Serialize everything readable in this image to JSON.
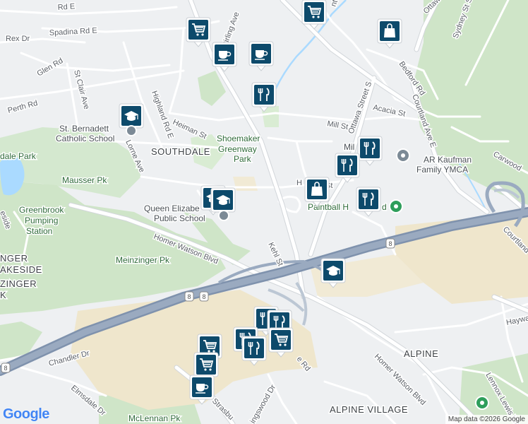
{
  "map": {
    "areas": {
      "southdale": "SOUTHDALE",
      "alpine": "ALPINE",
      "alpine_village": "ALPINE VILLAGE",
      "zinger": "ZINGER",
      "lakeside": "AKESIDE",
      "nger": "NGER",
      "k": "K"
    },
    "parks": {
      "shoemaker_1": "Shoemaker",
      "shoemaker_2": "Greenway",
      "shoemaker_3": "Park",
      "mausser": "Mausser Pk",
      "meinzinger": "Meinzinger Pk",
      "mclennan": "McLennan Pk",
      "dale_park": "dale Park"
    },
    "pois": {
      "st_bernadette_1": "St. Bernadett",
      "st_bernadette_2": "Catholic School",
      "queen_elizabeth_1": "Queen Elizabe",
      "queen_elizabeth_2": "Public School",
      "greenbrook_1": "Greenbrook",
      "greenbrook_2": "Pumping",
      "greenbrook_3": "Station",
      "ymca_1": "AR Kaufman",
      "ymca_2": "Family YMCA",
      "paintball": "Paintball H",
      "paintball_end": "d",
      "mill_short": "Mil",
      "h_st": "H",
      "st_frag": "St"
    },
    "streets": {
      "rd_e": "Rd E",
      "spadina": "Spadina Rd E",
      "rex": "Rex Dr",
      "glen": "Glen Rd",
      "perth": "Perth Rd",
      "st_clair": "St Clair Ave",
      "stirling": "Stirling Ave",
      "highland": "Highland Rd E",
      "heiman": "Heiman St",
      "lorne": "Lorne Ave",
      "homer_watson_w": "Homer Watson Blvd",
      "homer_watson_e": "Homer Watson Blvd",
      "kehl": "Kehl St",
      "mill": "Mill St",
      "acacia": "Acacia St",
      "bedford": "Bedford Rd",
      "ottawa_s": "Ottawa Street S",
      "courtland_1": "Courtland Ave E",
      "courtland_2": "Courtland",
      "ottawa_top": "Ottawa",
      "sydney": "Sydney St S",
      "carwood": "Carwood",
      "hayward": "Haywa",
      "lennox": "Lennox Lewis Way",
      "chandler": "Chandler Dr",
      "elmsdale": "Elmsdale Dr",
      "strasburg": "Strasbu",
      "wingswood": "ingswood Dr",
      "rd_frag": "e Rd",
      "esideside": "eside",
      "dr_frag": "Dr",
      "nt_frag": "nt"
    },
    "highway_number": "8",
    "attribution": "Map data ©2026 Google",
    "logo": "Google",
    "colors": {
      "highway": "#8a9bb5",
      "park": "#c8e6c9",
      "water": "#aadaff",
      "commercial": "#efe6cc",
      "pin": "#0d4a6b",
      "restaurant_pin": "#0d4a6b"
    }
  },
  "pins": [
    {
      "type": "shopping-cart",
      "label": "shopping-cart-icon"
    },
    {
      "type": "shopping-cart",
      "label": "shopping-cart-icon"
    },
    {
      "type": "shopping-bag",
      "label": "shopping-bag-icon"
    },
    {
      "type": "coffee",
      "label": "coffee-icon"
    },
    {
      "type": "coffee",
      "label": "coffee-icon"
    },
    {
      "type": "restaurant",
      "label": "restaurant-icon"
    },
    {
      "type": "school",
      "label": "school-icon"
    },
    {
      "type": "restaurant",
      "label": "restaurant-icon"
    },
    {
      "type": "restaurant",
      "label": "restaurant-icon"
    },
    {
      "type": "shopping-bag",
      "label": "shopping-bag-icon"
    },
    {
      "type": "restaurant",
      "label": "restaurant-icon"
    },
    {
      "type": "school",
      "label": "school-icon"
    },
    {
      "type": "school",
      "label": "school-icon"
    },
    {
      "type": "school",
      "label": "school-icon"
    },
    {
      "type": "restaurant",
      "label": "restaurant-icon"
    },
    {
      "type": "restaurant",
      "label": "restaurant-icon"
    },
    {
      "type": "restaurant",
      "label": "restaurant-icon"
    },
    {
      "type": "shopping-cart",
      "label": "shopping-cart-icon"
    },
    {
      "type": "shopping-cart",
      "label": "shopping-cart-icon"
    },
    {
      "type": "shopping-cart",
      "label": "shopping-cart-icon"
    },
    {
      "type": "coffee",
      "label": "coffee-icon"
    },
    {
      "type": "restaurant",
      "label": "restaurant-icon"
    }
  ]
}
